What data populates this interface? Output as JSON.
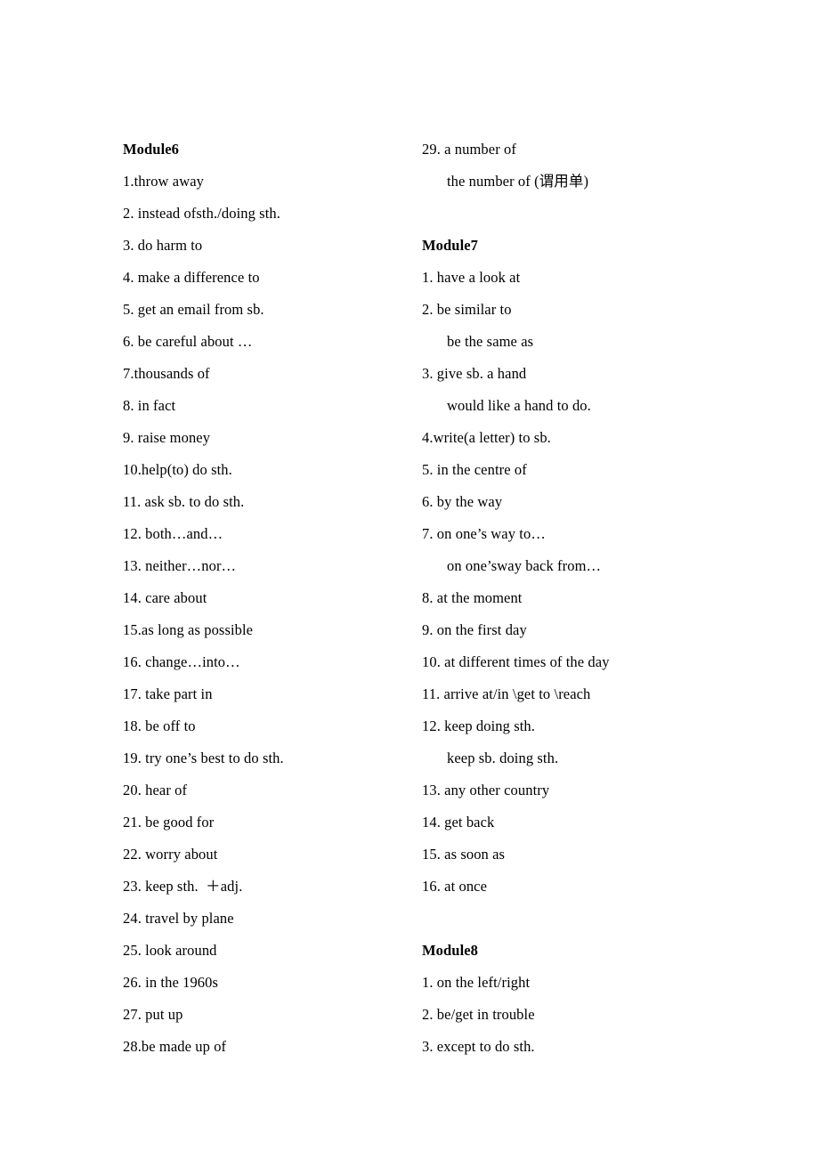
{
  "document": {
    "title": "Module6 Module7 Module8 Phrase List",
    "background_color": "#ffffff",
    "text_color": "#000000"
  },
  "columns": {
    "left": {
      "lines": [
        {
          "text": "Module6",
          "style": "heading"
        },
        {
          "text": "1.throw away",
          "style": "item"
        },
        {
          "text": "2. instead ofsth./doing sth.",
          "style": "item"
        },
        {
          "text": "3. do harm to",
          "style": "item"
        },
        {
          "text": "4. make a difference to",
          "style": "item"
        },
        {
          "text": "5. get an email from sb.",
          "style": "item"
        },
        {
          "text": "6. be careful about …",
          "style": "item"
        },
        {
          "text": "7.thousands of",
          "style": "item"
        },
        {
          "text": "8. in fact",
          "style": "item"
        },
        {
          "text": "9. raise money",
          "style": "item"
        },
        {
          "text": "10.help(to) do sth.",
          "style": "item"
        },
        {
          "text": "11. ask sb. to do sth.",
          "style": "item"
        },
        {
          "text": "12. both…and…",
          "style": "item"
        },
        {
          "text": "13. neither…nor…",
          "style": "item"
        },
        {
          "text": "14. care about",
          "style": "item"
        },
        {
          "text": "15.as long as possible",
          "style": "item"
        },
        {
          "text": "16. change…into…",
          "style": "item"
        },
        {
          "text": "17. take part in",
          "style": "item"
        },
        {
          "text": "18. be off to",
          "style": "item"
        },
        {
          "text": "19. try one’s best to do sth.",
          "style": "item"
        },
        {
          "text": "20. hear of",
          "style": "item"
        },
        {
          "text": "21. be good for",
          "style": "item"
        },
        {
          "text": "22. worry about",
          "style": "item"
        },
        {
          "text": "23. keep sth.  ＋adj.",
          "style": "item"
        },
        {
          "text": "24. travel by plane",
          "style": "item"
        },
        {
          "text": "25. look around",
          "style": "item"
        },
        {
          "text": "26. in the 1960s",
          "style": "item"
        },
        {
          "text": "27. put up",
          "style": "item"
        },
        {
          "text": "28.be made up of",
          "style": "item"
        }
      ]
    },
    "right": {
      "lines": [
        {
          "text": "29. a number of",
          "style": "item"
        },
        {
          "text": "the number of (谓用单)",
          "style": "sub"
        },
        {
          "text": "",
          "style": "spacer"
        },
        {
          "text": "Module7",
          "style": "heading"
        },
        {
          "text": "1. have a look at",
          "style": "item"
        },
        {
          "text": "2. be similar to",
          "style": "item"
        },
        {
          "text": "be the same as",
          "style": "sub"
        },
        {
          "text": "3. give sb. a hand",
          "style": "item"
        },
        {
          "text": "would like a hand to do.",
          "style": "sub"
        },
        {
          "text": "4.write(a letter) to sb.",
          "style": "item"
        },
        {
          "text": "5. in the centre of",
          "style": "item"
        },
        {
          "text": "6. by the way",
          "style": "item"
        },
        {
          "text": "7. on one’s way to…",
          "style": "item"
        },
        {
          "text": "on one’sway back from…",
          "style": "sub"
        },
        {
          "text": "8. at the moment",
          "style": "item"
        },
        {
          "text": "9. on the first day",
          "style": "item"
        },
        {
          "text": "10. at different times of the day",
          "style": "item"
        },
        {
          "text": "11. arrive at/in \\get to \\reach",
          "style": "item"
        },
        {
          "text": "12. keep doing sth.",
          "style": "item"
        },
        {
          "text": "keep sb. doing sth.",
          "style": "sub"
        },
        {
          "text": "13. any other country",
          "style": "item"
        },
        {
          "text": "14. get back",
          "style": "item"
        },
        {
          "text": "15. as soon as",
          "style": "item"
        },
        {
          "text": "16. at once",
          "style": "item"
        },
        {
          "text": "",
          "style": "spacer"
        },
        {
          "text": "Module8",
          "style": "heading"
        },
        {
          "text": "1. on the left/right",
          "style": "item"
        },
        {
          "text": "2. be/get in trouble",
          "style": "item"
        },
        {
          "text": "3. except to do sth.",
          "style": "item"
        }
      ]
    }
  }
}
